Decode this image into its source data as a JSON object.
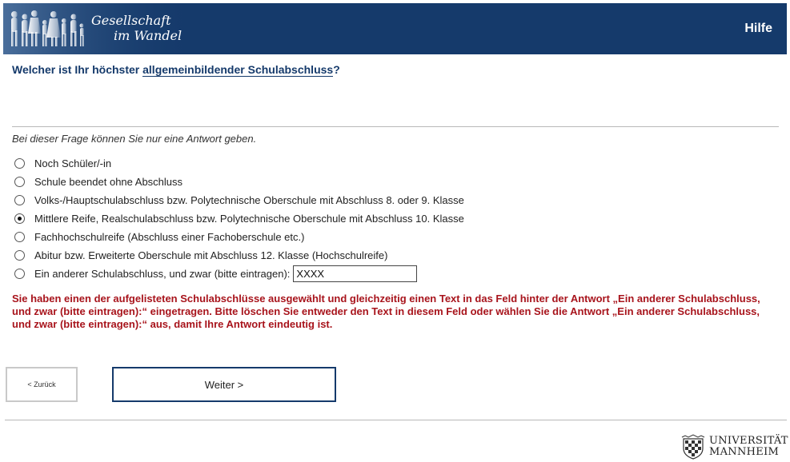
{
  "header": {
    "logo_line1": "Gesellschaft",
    "logo_line2": "im Wandel",
    "help_label": "Hilfe",
    "background_color": "#153a6b"
  },
  "question": {
    "text_before": "Welcher ist Ihr höchster ",
    "term": "allgemeinbildender Schulabschluss",
    "text_after": "?"
  },
  "instruction": "Bei dieser Frage können Sie nur eine Antwort geben.",
  "options": [
    {
      "label": "Noch Schüler/-in",
      "checked": false
    },
    {
      "label": "Schule beendet ohne Abschluss",
      "checked": false
    },
    {
      "label": "Volks-/Hauptschulabschluss bzw. Polytechnische Oberschule mit Abschluss 8. oder 9. Klasse",
      "checked": false
    },
    {
      "label": "Mittlere Reife, Realschulabschluss bzw. Polytechnische Oberschule mit Abschluss 10. Klasse",
      "checked": true
    },
    {
      "label": "Fachhochschulreife (Abschluss einer Fachoberschule etc.)",
      "checked": false
    },
    {
      "label": "Abitur bzw. Erweiterte Oberschule mit Abschluss 12. Klasse (Hochschulreife)",
      "checked": false
    },
    {
      "label": "Ein anderer Schulabschluss, und zwar (bitte eintragen):",
      "checked": false,
      "input_value": "XXXX"
    }
  ],
  "error_message": "Sie haben einen der aufgelisteten Schulabschlüsse ausgewählt und gleichzeitig einen Text in das Feld hinter der Antwort „Ein anderer Schulabschluss, und zwar (bitte eintragen):“ eingetragen. Bitte löschen Sie entweder den Text in diesem Feld oder wählen Sie die Antwort „Ein anderer Schulabschluss, und zwar (bitte eintragen):“ aus, damit Ihre Antwort eindeutig ist.",
  "error_color": "#a8141c",
  "nav": {
    "back_label": "< Zurück",
    "next_label": "Weiter >"
  },
  "footer": {
    "uni_line1": "UNIVERSITÄT",
    "uni_line2": "MANNHEIM"
  }
}
